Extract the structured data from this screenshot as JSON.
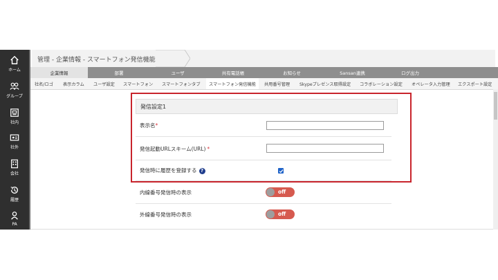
{
  "breadcrumb": {
    "text": "管理 - 企業情報 - スマートフォン発信機能"
  },
  "sidebar": {
    "items": [
      {
        "label": "ホーム",
        "icon": "home-icon"
      },
      {
        "label": "グループ",
        "icon": "group-icon"
      },
      {
        "label": "社内",
        "icon": "building-icon"
      },
      {
        "label": "社外",
        "icon": "card-icon"
      },
      {
        "label": "会社",
        "icon": "company-icon"
      },
      {
        "label": "履歴",
        "icon": "history-icon"
      },
      {
        "label": "PA",
        "icon": "person-icon"
      }
    ]
  },
  "main_tabs": [
    {
      "label": "企業情報",
      "active": true
    },
    {
      "label": "部署",
      "active": false
    },
    {
      "label": "ユーザ",
      "active": false
    },
    {
      "label": "共有電話帳",
      "active": false
    },
    {
      "label": "お知らせ",
      "active": false
    },
    {
      "label": "Sansan連携",
      "active": false
    },
    {
      "label": "ログ出力",
      "active": false
    }
  ],
  "sub_tabs": [
    {
      "label": "社名/ロゴ",
      "active": false
    },
    {
      "label": "表示カラム",
      "active": false
    },
    {
      "label": "ユーザ設定",
      "active": false
    },
    {
      "label": "スマートフォン",
      "active": false
    },
    {
      "label": "スマートフォンタブ",
      "active": false
    },
    {
      "label": "スマートフォン発信機能",
      "active": true
    },
    {
      "label": "共用番号管理",
      "active": false
    },
    {
      "label": "Skypeプレゼンス取得設定",
      "active": false
    },
    {
      "label": "コラボレーション設定",
      "active": false
    },
    {
      "label": "オペレータ入力管理",
      "active": false
    },
    {
      "label": "エクスポート設定",
      "active": false
    }
  ],
  "section": {
    "title": "発信設定1"
  },
  "fields": {
    "display_name": {
      "label": "表示名",
      "required_mark": "*",
      "value": ""
    },
    "url_scheme": {
      "label": "発信起動URLスキーム(URL)",
      "required_mark": "*",
      "value": ""
    },
    "register_history": {
      "label": "発信時に履歴を登録する",
      "help": "?",
      "checked": true
    }
  },
  "toggles": {
    "internal": {
      "label": "内線番号発信時の表示",
      "state": "off"
    },
    "external": {
      "label": "外線番号発信時の表示",
      "state": "off"
    }
  },
  "colors": {
    "sidebar": "#2f2f2f",
    "highlight": "#c8232b",
    "toggle_off": "#d65a4f",
    "checkbox": "#1f63c8",
    "required": "#d9363e"
  }
}
